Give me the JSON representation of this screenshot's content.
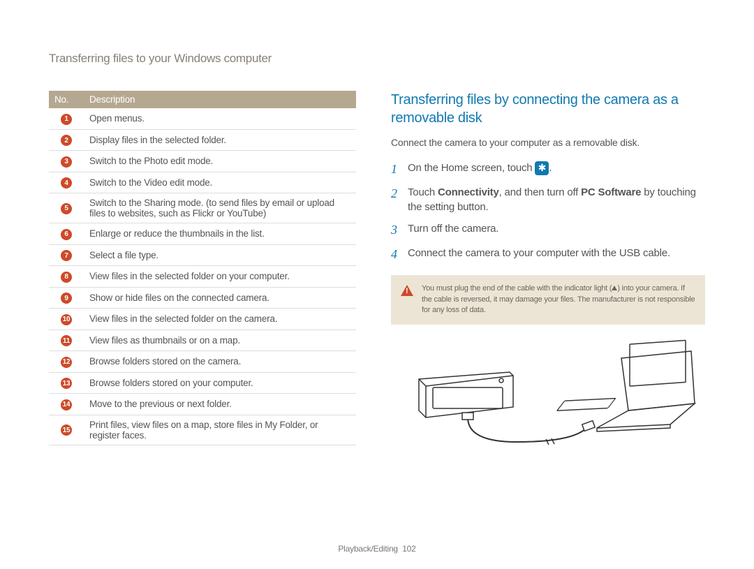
{
  "header": "Transferring files to your Windows computer",
  "table": {
    "head_no": "No.",
    "head_desc": "Description",
    "rows": [
      {
        "num": "1",
        "desc": "Open menus."
      },
      {
        "num": "2",
        "desc": "Display files in the selected folder."
      },
      {
        "num": "3",
        "desc": "Switch to the Photo edit mode."
      },
      {
        "num": "4",
        "desc": "Switch to the Video edit mode."
      },
      {
        "num": "5",
        "desc": "Switch to the Sharing mode. (to send files by email or upload files to websites, such as Flickr or YouTube)"
      },
      {
        "num": "6",
        "desc": "Enlarge or reduce the thumbnails in the list."
      },
      {
        "num": "7",
        "desc": "Select a file type."
      },
      {
        "num": "8",
        "desc": "View files in the selected folder on your computer."
      },
      {
        "num": "9",
        "desc": "Show or hide files on the connected camera."
      },
      {
        "num": "10",
        "desc": "View files in the selected folder on the camera."
      },
      {
        "num": "11",
        "desc": "View files as thumbnails or on a map."
      },
      {
        "num": "12",
        "desc": "Browse folders stored on the camera."
      },
      {
        "num": "13",
        "desc": "Browse folders stored on your computer."
      },
      {
        "num": "14",
        "desc": "Move to the previous or next folder."
      },
      {
        "num": "15",
        "desc": "Print files, view files on a map, store files in My Folder, or register faces."
      }
    ]
  },
  "right": {
    "title": "Transferring files by connecting the camera as a removable disk",
    "intro": "Connect the camera to your computer as a removable disk.",
    "step1_pre": "On the Home screen, touch ",
    "step2_pre": "Touch ",
    "step2_bold1": "Connectivity",
    "step2_mid": ", and then turn off ",
    "step2_bold2": "PC Software",
    "step2_suf": " by touching the setting button.",
    "step3": "Turn off the camera.",
    "step4": "Connect the camera to your computer with the USB cable.",
    "note_pre": "You must plug the end of the cable with the indicator light (",
    "note_suf": ") into your camera. If the cable is reversed, it may damage your files. The manufacturer is not responsible for any loss of data.",
    "nums": {
      "n1": "1",
      "n2": "2",
      "n3": "3",
      "n4": "4"
    }
  },
  "footer": {
    "section": "Playback/Editing",
    "page": "102"
  }
}
